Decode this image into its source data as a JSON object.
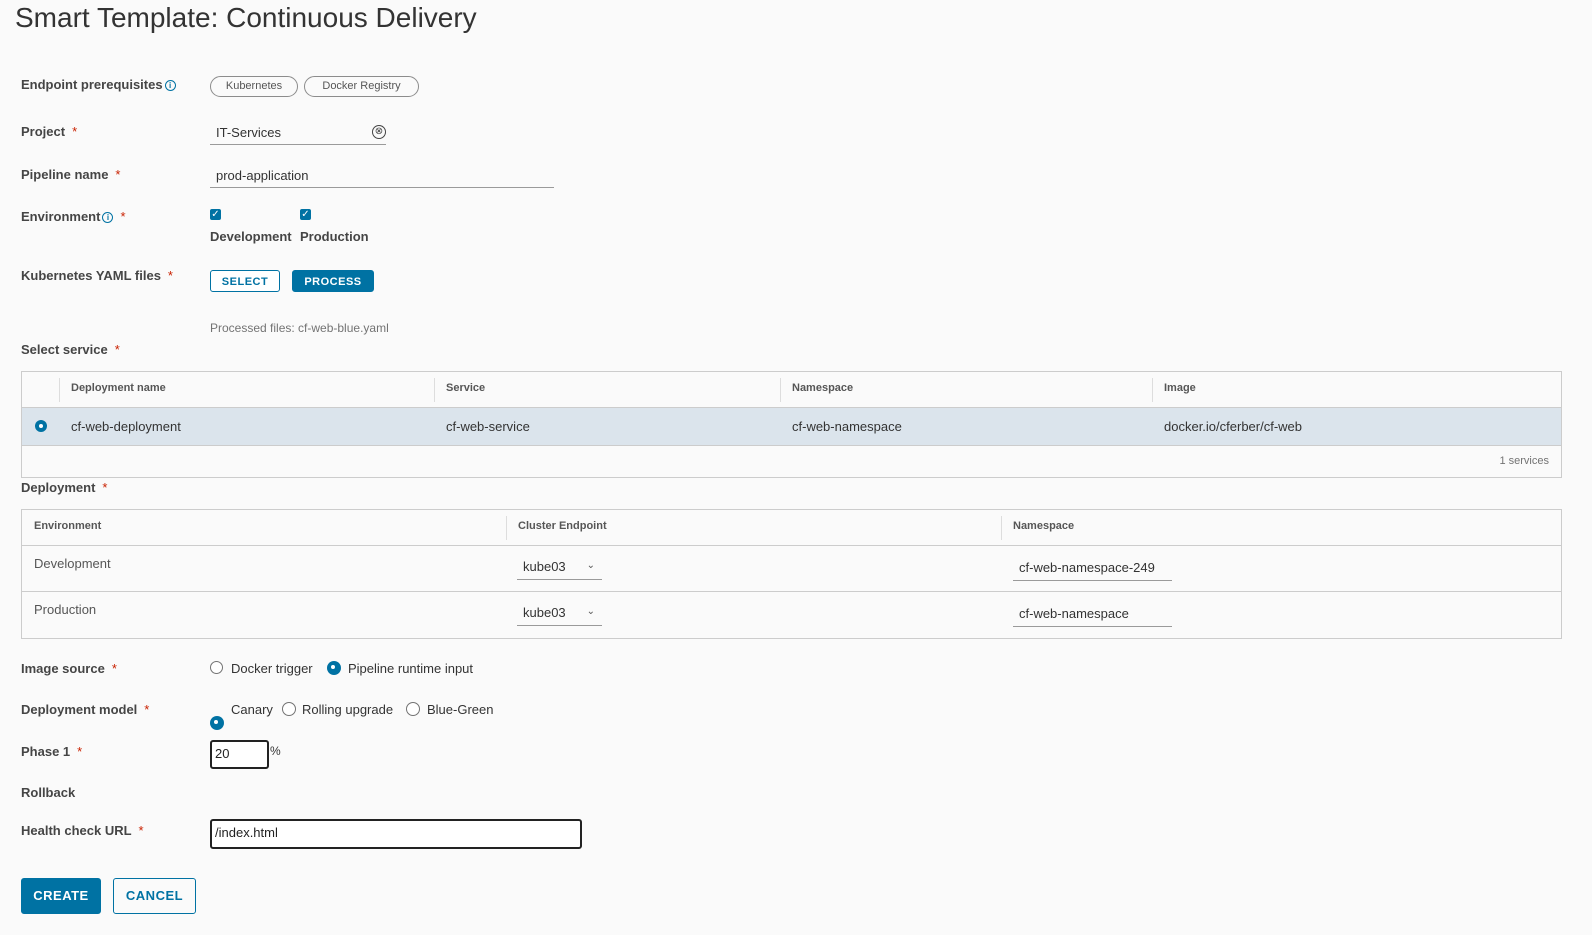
{
  "page": {
    "title": "Smart Template: Continuous Delivery"
  },
  "endpoint": {
    "label": "Endpoint prerequisites",
    "pills": [
      "Kubernetes",
      "Docker Registry"
    ]
  },
  "project": {
    "label": "Project",
    "value": "IT-Services"
  },
  "pipeline": {
    "label": "Pipeline name",
    "value": "prod-application"
  },
  "environment": {
    "label": "Environment",
    "options": [
      {
        "label": "Development",
        "checked": true
      },
      {
        "label": "Production",
        "checked": true
      }
    ]
  },
  "yaml": {
    "label": "Kubernetes YAML files",
    "select_label": "SELECT",
    "process_label": "PROCESS",
    "processed_text": "Processed files: cf-web-blue.yaml"
  },
  "service": {
    "label": "Select service",
    "columns": [
      "Deployment name",
      "Service",
      "Namespace",
      "Image"
    ],
    "rows": [
      {
        "selected": true,
        "deployment": "cf-web-deployment",
        "service": "cf-web-service",
        "namespace": "cf-web-namespace",
        "image": "docker.io/cferber/cf-web"
      }
    ],
    "footer": "1 services"
  },
  "deployment": {
    "label": "Deployment",
    "columns": [
      "Environment",
      "Cluster Endpoint",
      "Namespace"
    ],
    "rows": [
      {
        "environment": "Development",
        "cluster": "kube03",
        "namespace": "cf-web-namespace-249"
      },
      {
        "environment": "Production",
        "cluster": "kube03",
        "namespace": "cf-web-namespace"
      }
    ]
  },
  "image_source": {
    "label": "Image source",
    "options": [
      {
        "label": "Docker trigger",
        "selected": false
      },
      {
        "label": "Pipeline runtime input",
        "selected": true
      }
    ]
  },
  "deployment_model": {
    "label": "Deployment model",
    "options": [
      {
        "label": "Canary",
        "selected": true
      },
      {
        "label": "Rolling upgrade",
        "selected": false
      },
      {
        "label": "Blue-Green",
        "selected": false
      }
    ]
  },
  "phase1": {
    "label": "Phase 1",
    "value": "20",
    "unit": "%"
  },
  "rollback": {
    "label": "Rollback"
  },
  "health": {
    "label": "Health check URL",
    "value": "/index.html"
  },
  "actions": {
    "create_label": "CREATE",
    "cancel_label": "CANCEL"
  },
  "colors": {
    "accent": "#0072a3",
    "required": "#c92100",
    "selected_row": "#dbe4ec"
  },
  "required_mark": "*",
  "icons": {
    "info": "i",
    "clear": "⊗",
    "check": "✓",
    "chevron": "⌄"
  }
}
